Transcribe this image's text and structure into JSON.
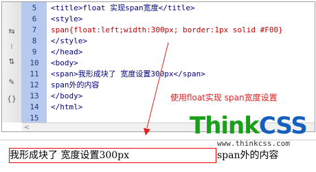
{
  "editor": {
    "line_numbers": [
      "5",
      "6",
      "7",
      "8",
      "9",
      "10",
      "11",
      "12",
      "13",
      "14",
      "15"
    ],
    "lines": [
      "<title>float 实现span宽度</title>",
      "<style>",
      "span{float:left;width:300px; border:1px solid #F00}",
      "</style>",
      "</head>",
      "<body>",
      "<span>我形成块了 宽度设置300px</span>",
      "span外的内容",
      "</body>",
      "</html>",
      ""
    ],
    "toolbar_icons": [
      "format-icon",
      "wrap-icon",
      "split-icon",
      "highlight-icon",
      "braces-icon"
    ],
    "scroll_arrow": "<"
  },
  "annotation": {
    "text": "使用float实现 span宽度设置"
  },
  "logo": {
    "part1": "Think",
    "part2": "CSS",
    "url": "www.thinkcss.com"
  },
  "preview": {
    "span_text": "我形成块了 宽度设置300px",
    "after_text": "span外的内容"
  },
  "colors": {
    "accent": "#e02020",
    "gutter": "#b7c9ee",
    "logo_green": "#1a9f1a",
    "logo_blue": "#1560bd"
  }
}
